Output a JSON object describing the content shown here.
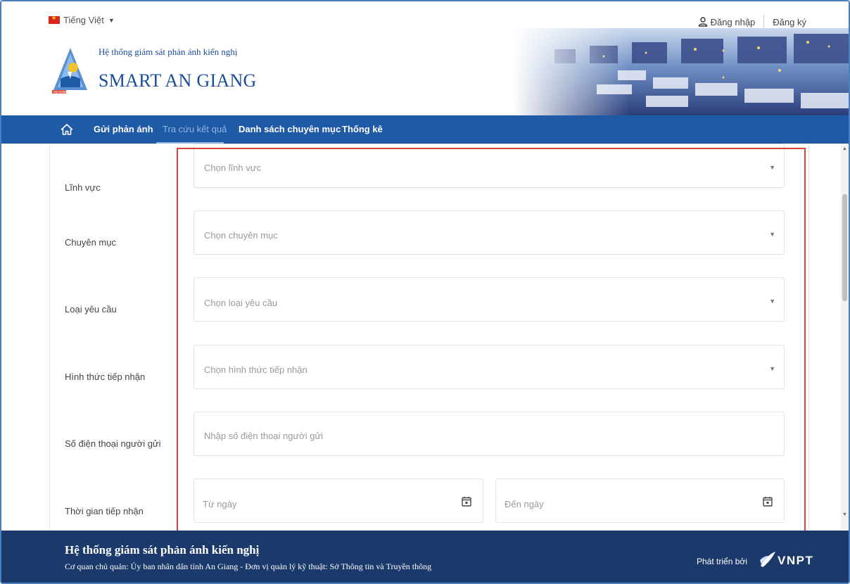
{
  "header": {
    "language": "Tiếng Việt",
    "login": "Đăng nhập",
    "register": "Đăng ký",
    "system_title_small": "Hệ thống giám sát phản ánh kiến nghị",
    "system_title_big": "SMART AN GIANG",
    "logo_text": "AN GIANG"
  },
  "nav": {
    "items": [
      {
        "label": "Gửi phản ánh"
      },
      {
        "label": "Tra cứu kết quả"
      },
      {
        "label": "Danh sách chuyên mục"
      },
      {
        "label": "Thống kê"
      }
    ],
    "active": "Tra cứu kết quả"
  },
  "form": {
    "fields": [
      {
        "label": "Lĩnh vực",
        "placeholder": "Chọn lĩnh vực"
      },
      {
        "label": "Chuyên mục",
        "placeholder": "Chọn chuyên mục"
      },
      {
        "label": "Loại yêu cầu",
        "placeholder": "Chọn loại yêu cầu"
      },
      {
        "label": "Hình thức tiếp nhận",
        "placeholder": "Chọn hình thức tiếp nhận"
      },
      {
        "label": "Số điện thoại người gửi",
        "placeholder": "Nhập số điện thoại người gửi"
      },
      {
        "label": "Thời gian tiếp nhận",
        "from_placeholder": "Từ ngày",
        "to_placeholder": "Đến ngày"
      }
    ]
  },
  "footer": {
    "title": "Hệ thống giám sát phản ánh kiến nghị",
    "subtitle": "Cơ quan chủ quản: Ủy ban nhân dân tỉnh An Giang - Đơn vị quản lý kỹ thuật: Sở Thông tin và Truyền thông",
    "developed_by": "Phát triển bởi",
    "brand": "VNPT"
  },
  "colors": {
    "nav_bg": "#1f5aa6",
    "footer_bg": "#1b3a6b",
    "title_blue": "#1a4c9c",
    "highlight_red": "#e0403a"
  }
}
